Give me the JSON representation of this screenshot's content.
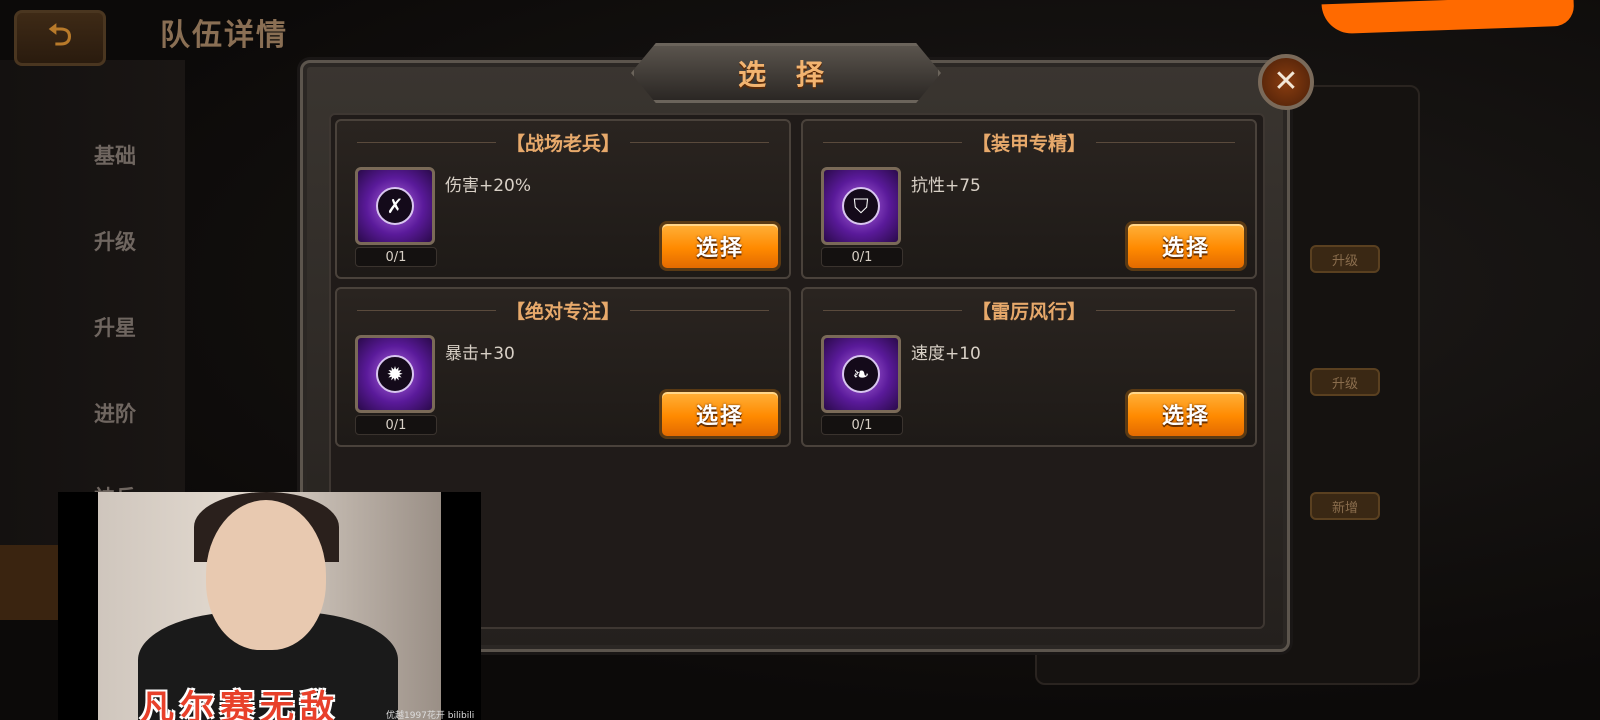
{
  "header": {
    "back_glyph": "⮌",
    "title": "队伍详情"
  },
  "sidebar": {
    "items": [
      "基础",
      "升级",
      "升星",
      "进阶",
      "神兵"
    ]
  },
  "background_buttons": [
    "升级",
    "升级",
    "新增"
  ],
  "modal": {
    "title": "选 择",
    "close_glyph": "✕",
    "cards": [
      {
        "title": "【战场老兵】",
        "icon": "sword-icon",
        "glyph": "✗",
        "desc": "伤害+20%",
        "count": "0/1",
        "button": "选择"
      },
      {
        "title": "【装甲专精】",
        "icon": "shield-icon",
        "glyph": "⛉",
        "desc": "抗性+75",
        "count": "0/1",
        "button": "选择"
      },
      {
        "title": "【绝对专注】",
        "icon": "burst-icon",
        "glyph": "✹",
        "desc": "暴击+30",
        "count": "0/1",
        "button": "选择"
      },
      {
        "title": "【雷厉风行】",
        "icon": "wind-icon",
        "glyph": "❧",
        "desc": "速度+10",
        "count": "0/1",
        "button": "选择"
      }
    ]
  },
  "overlay": {
    "caption": "凡尔赛无敌",
    "watermark": "优越1997花开 bilibili"
  },
  "colors": {
    "accent": "#ff8a00",
    "title": "#e7a96b",
    "skill": "#7a2ac0"
  }
}
